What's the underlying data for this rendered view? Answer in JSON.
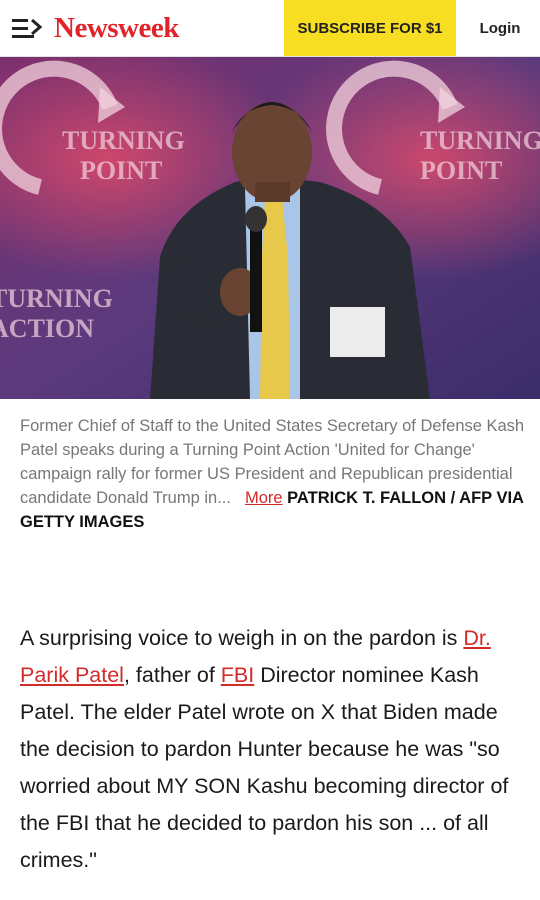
{
  "header": {
    "brand": "Newsweek",
    "subscribe_label": "SUBSCRIBE FOR $1",
    "login_label": "Login"
  },
  "photo": {
    "background_sign_text": [
      "TURNING",
      "POINT",
      "ACTION"
    ]
  },
  "caption": {
    "text": "Former Chief of Staff to the United States Secretary of Defense Kash Patel speaks during a Turning Point Action 'United for Change' campaign rally for former US President and Republican presidential candidate Donald Trump in...",
    "more_label": "More",
    "credit": "PATRICK T. FALLON / AFP VIA GETTY IMAGES"
  },
  "article": {
    "part1": "A surprising voice to weigh in on the pardon is ",
    "link1": "Dr. Parik Patel",
    "part2": ", father of ",
    "link2": "FBI",
    "part3": " Director nominee Kash Patel. The elder Patel wrote on X that Biden made the decision to pardon Hunter because he was \"so worried about MY SON Kashu becoming director of the FBI that he decided to pardon his son ... of all crimes.\""
  },
  "colors": {
    "brand_red": "#e0242a",
    "subscribe_yellow": "#f8de22",
    "link_red": "#d32a2a"
  }
}
